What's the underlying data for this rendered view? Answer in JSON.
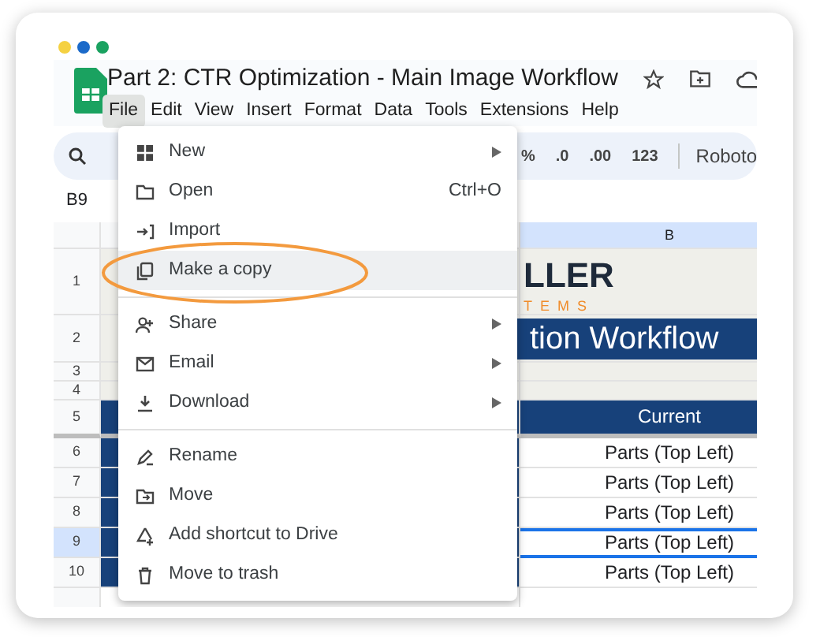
{
  "window": {
    "dots": [
      {
        "color": "#f5d142"
      },
      {
        "color": "#1b6ac9"
      },
      {
        "color": "#1aa260"
      }
    ]
  },
  "document": {
    "title": "Part 2: CTR Optimization - Main Image Workflow"
  },
  "menubar": [
    {
      "label": "File",
      "selected": true
    },
    {
      "label": "Edit",
      "selected": false
    },
    {
      "label": "View",
      "selected": false
    },
    {
      "label": "Insert",
      "selected": false
    },
    {
      "label": "Format",
      "selected": false
    },
    {
      "label": "Data",
      "selected": false
    },
    {
      "label": "Tools",
      "selected": false
    },
    {
      "label": "Extensions",
      "selected": false
    },
    {
      "label": "Help",
      "selected": false
    }
  ],
  "toolbar": {
    "items": [
      "%",
      ".0",
      ".00",
      "123"
    ],
    "font": "Roboto"
  },
  "name_box": "B9",
  "sheet": {
    "column_header": "B",
    "rows": [
      {
        "number": "1",
        "kind": "logo",
        "selected": false,
        "texts": [
          "LLER",
          "TEMS"
        ]
      },
      {
        "number": "2",
        "kind": "banner",
        "selected": false,
        "texts": [
          "tion Workflow"
        ]
      },
      {
        "number": "3",
        "kind": "blank",
        "selected": false,
        "texts": []
      },
      {
        "number": "4",
        "kind": "blank",
        "selected": false,
        "texts": []
      },
      {
        "number": "5",
        "kind": "header",
        "selected": false,
        "texts": [
          "Current"
        ]
      },
      {
        "number": "6",
        "kind": "data",
        "selected": false,
        "texts": [
          "Parts (Top Left)"
        ]
      },
      {
        "number": "7",
        "kind": "data",
        "selected": false,
        "texts": [
          "Parts (Top Left)"
        ]
      },
      {
        "number": "8",
        "kind": "data",
        "selected": false,
        "texts": [
          "Parts (Top Left)"
        ]
      },
      {
        "number": "9",
        "kind": "data",
        "selected": true,
        "texts": [
          "Parts (Top Left)"
        ]
      },
      {
        "number": "10",
        "kind": "data",
        "selected": false,
        "texts": [
          "Parts (Top Left)"
        ]
      }
    ]
  },
  "file_menu": {
    "items": [
      {
        "kind": "item",
        "label": "New",
        "submenu": true,
        "highlighted": false,
        "circled": false
      },
      {
        "kind": "item",
        "label": "Open",
        "shortcut": "Ctrl+O",
        "submenu": false,
        "highlighted": false,
        "circled": false
      },
      {
        "kind": "item",
        "label": "Import",
        "submenu": false,
        "highlighted": false,
        "circled": false
      },
      {
        "kind": "item",
        "label": "Make a copy",
        "submenu": false,
        "highlighted": true,
        "circled": true
      },
      {
        "kind": "divider"
      },
      {
        "kind": "item",
        "label": "Share",
        "submenu": true,
        "highlighted": false,
        "circled": false
      },
      {
        "kind": "item",
        "label": "Email",
        "submenu": true,
        "highlighted": false,
        "circled": false
      },
      {
        "kind": "item",
        "label": "Download",
        "submenu": true,
        "highlighted": false,
        "circled": false
      },
      {
        "kind": "divider"
      },
      {
        "kind": "item",
        "label": "Rename",
        "submenu": false,
        "highlighted": false,
        "circled": false
      },
      {
        "kind": "item",
        "label": "Move",
        "submenu": false,
        "highlighted": false,
        "circled": false
      },
      {
        "kind": "item",
        "label": "Add shortcut to Drive",
        "submenu": false,
        "highlighted": false,
        "circled": false
      },
      {
        "kind": "item",
        "label": "Move to trash",
        "submenu": false,
        "highlighted": false,
        "circled": false
      }
    ]
  }
}
